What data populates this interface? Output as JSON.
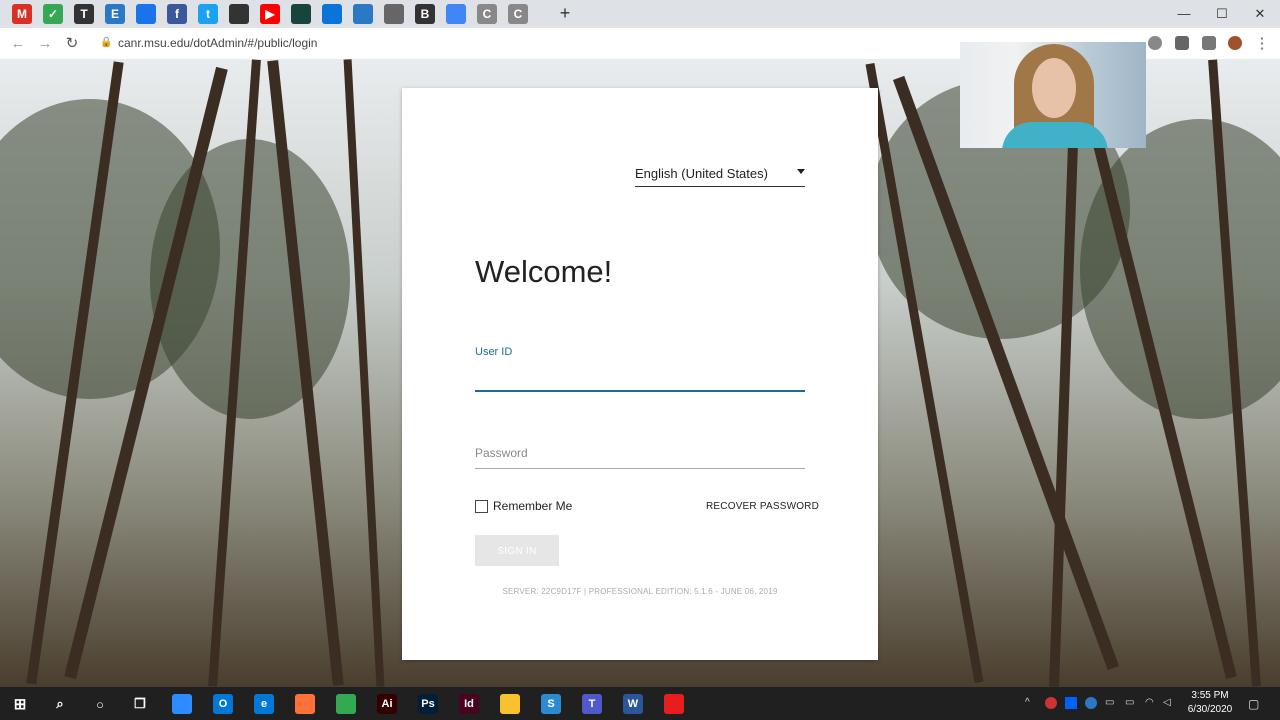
{
  "browser": {
    "url": "canr.msu.edu/dotAdmin/#/public/login",
    "new_tab_symbol": "+",
    "tabs": [
      {
        "icon": "gmail-icon",
        "glyph": "M",
        "color": "#d93025"
      },
      {
        "icon": "check-icon",
        "glyph": "✓",
        "color": "#34a853"
      },
      {
        "icon": "underline-icon",
        "glyph": "T",
        "color": "#333333"
      },
      {
        "icon": "e-app-icon",
        "glyph": "E",
        "color": "#2b78c5"
      },
      {
        "icon": "doc-icon",
        "glyph": "",
        "color": "#1a73e8"
      },
      {
        "icon": "facebook-icon",
        "glyph": "f",
        "color": "#3b5998"
      },
      {
        "icon": "twitter-icon",
        "glyph": "t",
        "color": "#1da1f2"
      },
      {
        "icon": "shield-icon",
        "glyph": "",
        "color": "#333333"
      },
      {
        "icon": "youtube-icon",
        "glyph": "▶",
        "color": "#ff0000"
      },
      {
        "icon": "spartan-icon",
        "glyph": "",
        "color": "#18453b"
      },
      {
        "icon": "cloud-icon",
        "glyph": "",
        "color": "#0a74d9"
      },
      {
        "icon": "page-icon",
        "glyph": "",
        "color": "#2b78c5"
      },
      {
        "icon": "bug-icon",
        "glyph": "",
        "color": "#666666"
      },
      {
        "icon": "bold-icon",
        "glyph": "B",
        "color": "#333333"
      },
      {
        "icon": "flow-icon",
        "glyph": "",
        "color": "#4285f4"
      },
      {
        "icon": "c-icon",
        "glyph": "C",
        "color": "#888888"
      },
      {
        "icon": "c-icon",
        "glyph": "C",
        "color": "#888888"
      }
    ]
  },
  "lang_select": {
    "value": "English (United States)"
  },
  "login": {
    "welcome": "Welcome!",
    "user_id_label": "User ID",
    "user_id_value": "",
    "password_placeholder": "Password",
    "remember_label": "Remember Me",
    "recover_label": "RECOVER PASSWORD",
    "signin_label": "SIGN IN",
    "server_info": "SERVER: 22C9D17F | PROFESSIONAL EDITION: 5.1.6 - JUNE 06, 2019"
  },
  "taskbar": {
    "time": "3:55 PM",
    "date": "6/30/2020",
    "apps": [
      {
        "name": "zoom-icon",
        "glyph": "",
        "color": "#2d8cff"
      },
      {
        "name": "outlook-icon",
        "glyph": "O",
        "color": "#0078d4"
      },
      {
        "name": "edge-icon",
        "glyph": "e",
        "color": "#0078d7"
      },
      {
        "name": "firefox-icon",
        "glyph": "",
        "color": "#ff7139"
      },
      {
        "name": "chrome-icon",
        "glyph": "",
        "color": "#34a853"
      },
      {
        "name": "illustrator-icon",
        "glyph": "Ai",
        "color": "#330000"
      },
      {
        "name": "photoshop-icon",
        "glyph": "Ps",
        "color": "#001e36"
      },
      {
        "name": "indesign-icon",
        "glyph": "Id",
        "color": "#49021f"
      },
      {
        "name": "file-explorer-icon",
        "glyph": "",
        "color": "#f8c12d"
      },
      {
        "name": "snagit-icon",
        "glyph": "S",
        "color": "#2c8ad0"
      },
      {
        "name": "teams-icon",
        "glyph": "T",
        "color": "#5059c9"
      },
      {
        "name": "word-icon",
        "glyph": "W",
        "color": "#2b579a"
      },
      {
        "name": "acrobat-icon",
        "glyph": "",
        "color": "#e81e1e"
      }
    ]
  }
}
